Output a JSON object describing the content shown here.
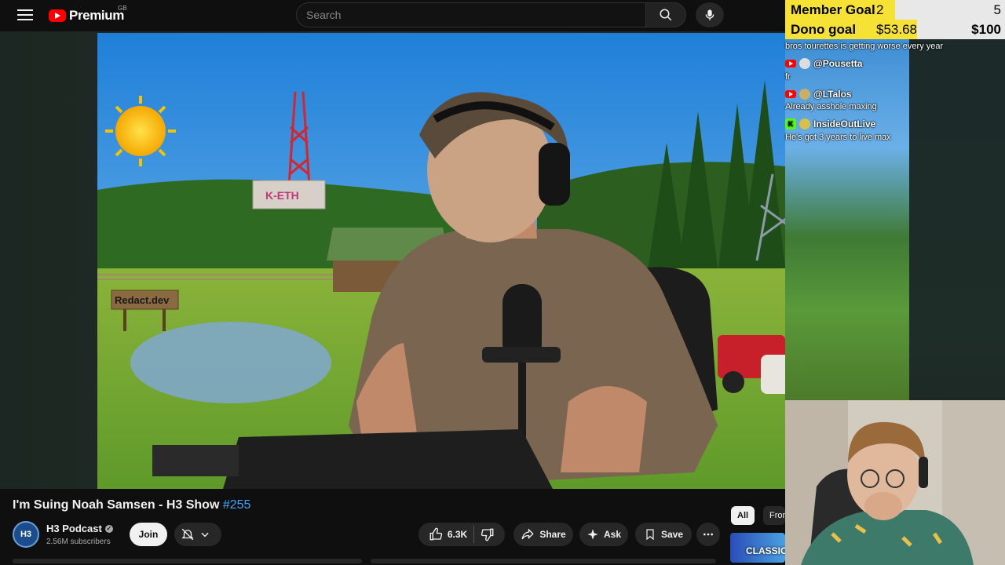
{
  "header": {
    "logo_text": "Premium",
    "region": "GB",
    "search_placeholder": "Search"
  },
  "stream_overlay": {
    "member_goal": {
      "label": "Member Goal",
      "current": "2",
      "target": "5"
    },
    "dono_goal": {
      "label": "Dono goal",
      "current": "$53.68",
      "target": "$100"
    },
    "chat": [
      {
        "platform": "",
        "user": "",
        "message": "bros tourettes is getting worse every year"
      },
      {
        "platform": "youtube",
        "user": "@Pousetta",
        "message": "fr"
      },
      {
        "platform": "youtube",
        "user": "@LTalos",
        "message": "Already asshole maxing"
      },
      {
        "platform": "kick",
        "user": "InsideOutLive",
        "message": "He's got 3 years to live max"
      }
    ]
  },
  "video_scene": {
    "sign_text": "Redact.dev",
    "building_sign": "K-ETH"
  },
  "video": {
    "title": "I'm Suing Noah Samsen - H3 Show",
    "title_tag": "#255",
    "channel_name": "H3 Podcast",
    "channel_avatar_text": "H3",
    "subscribers": "2.56M subscribers",
    "join_label": "Join",
    "like_count": "6.3K",
    "share_label": "Share",
    "ask_label": "Ask",
    "save_label": "Save"
  },
  "chips": {
    "all": "All",
    "from": "From"
  },
  "recommendation": {
    "thumb_label": "CLASSIC"
  },
  "colors": {
    "accent_link": "#3ea6ff",
    "goal_bar": "#f5e234",
    "yt_red": "#ff0000",
    "kick_green": "#53fc18"
  }
}
